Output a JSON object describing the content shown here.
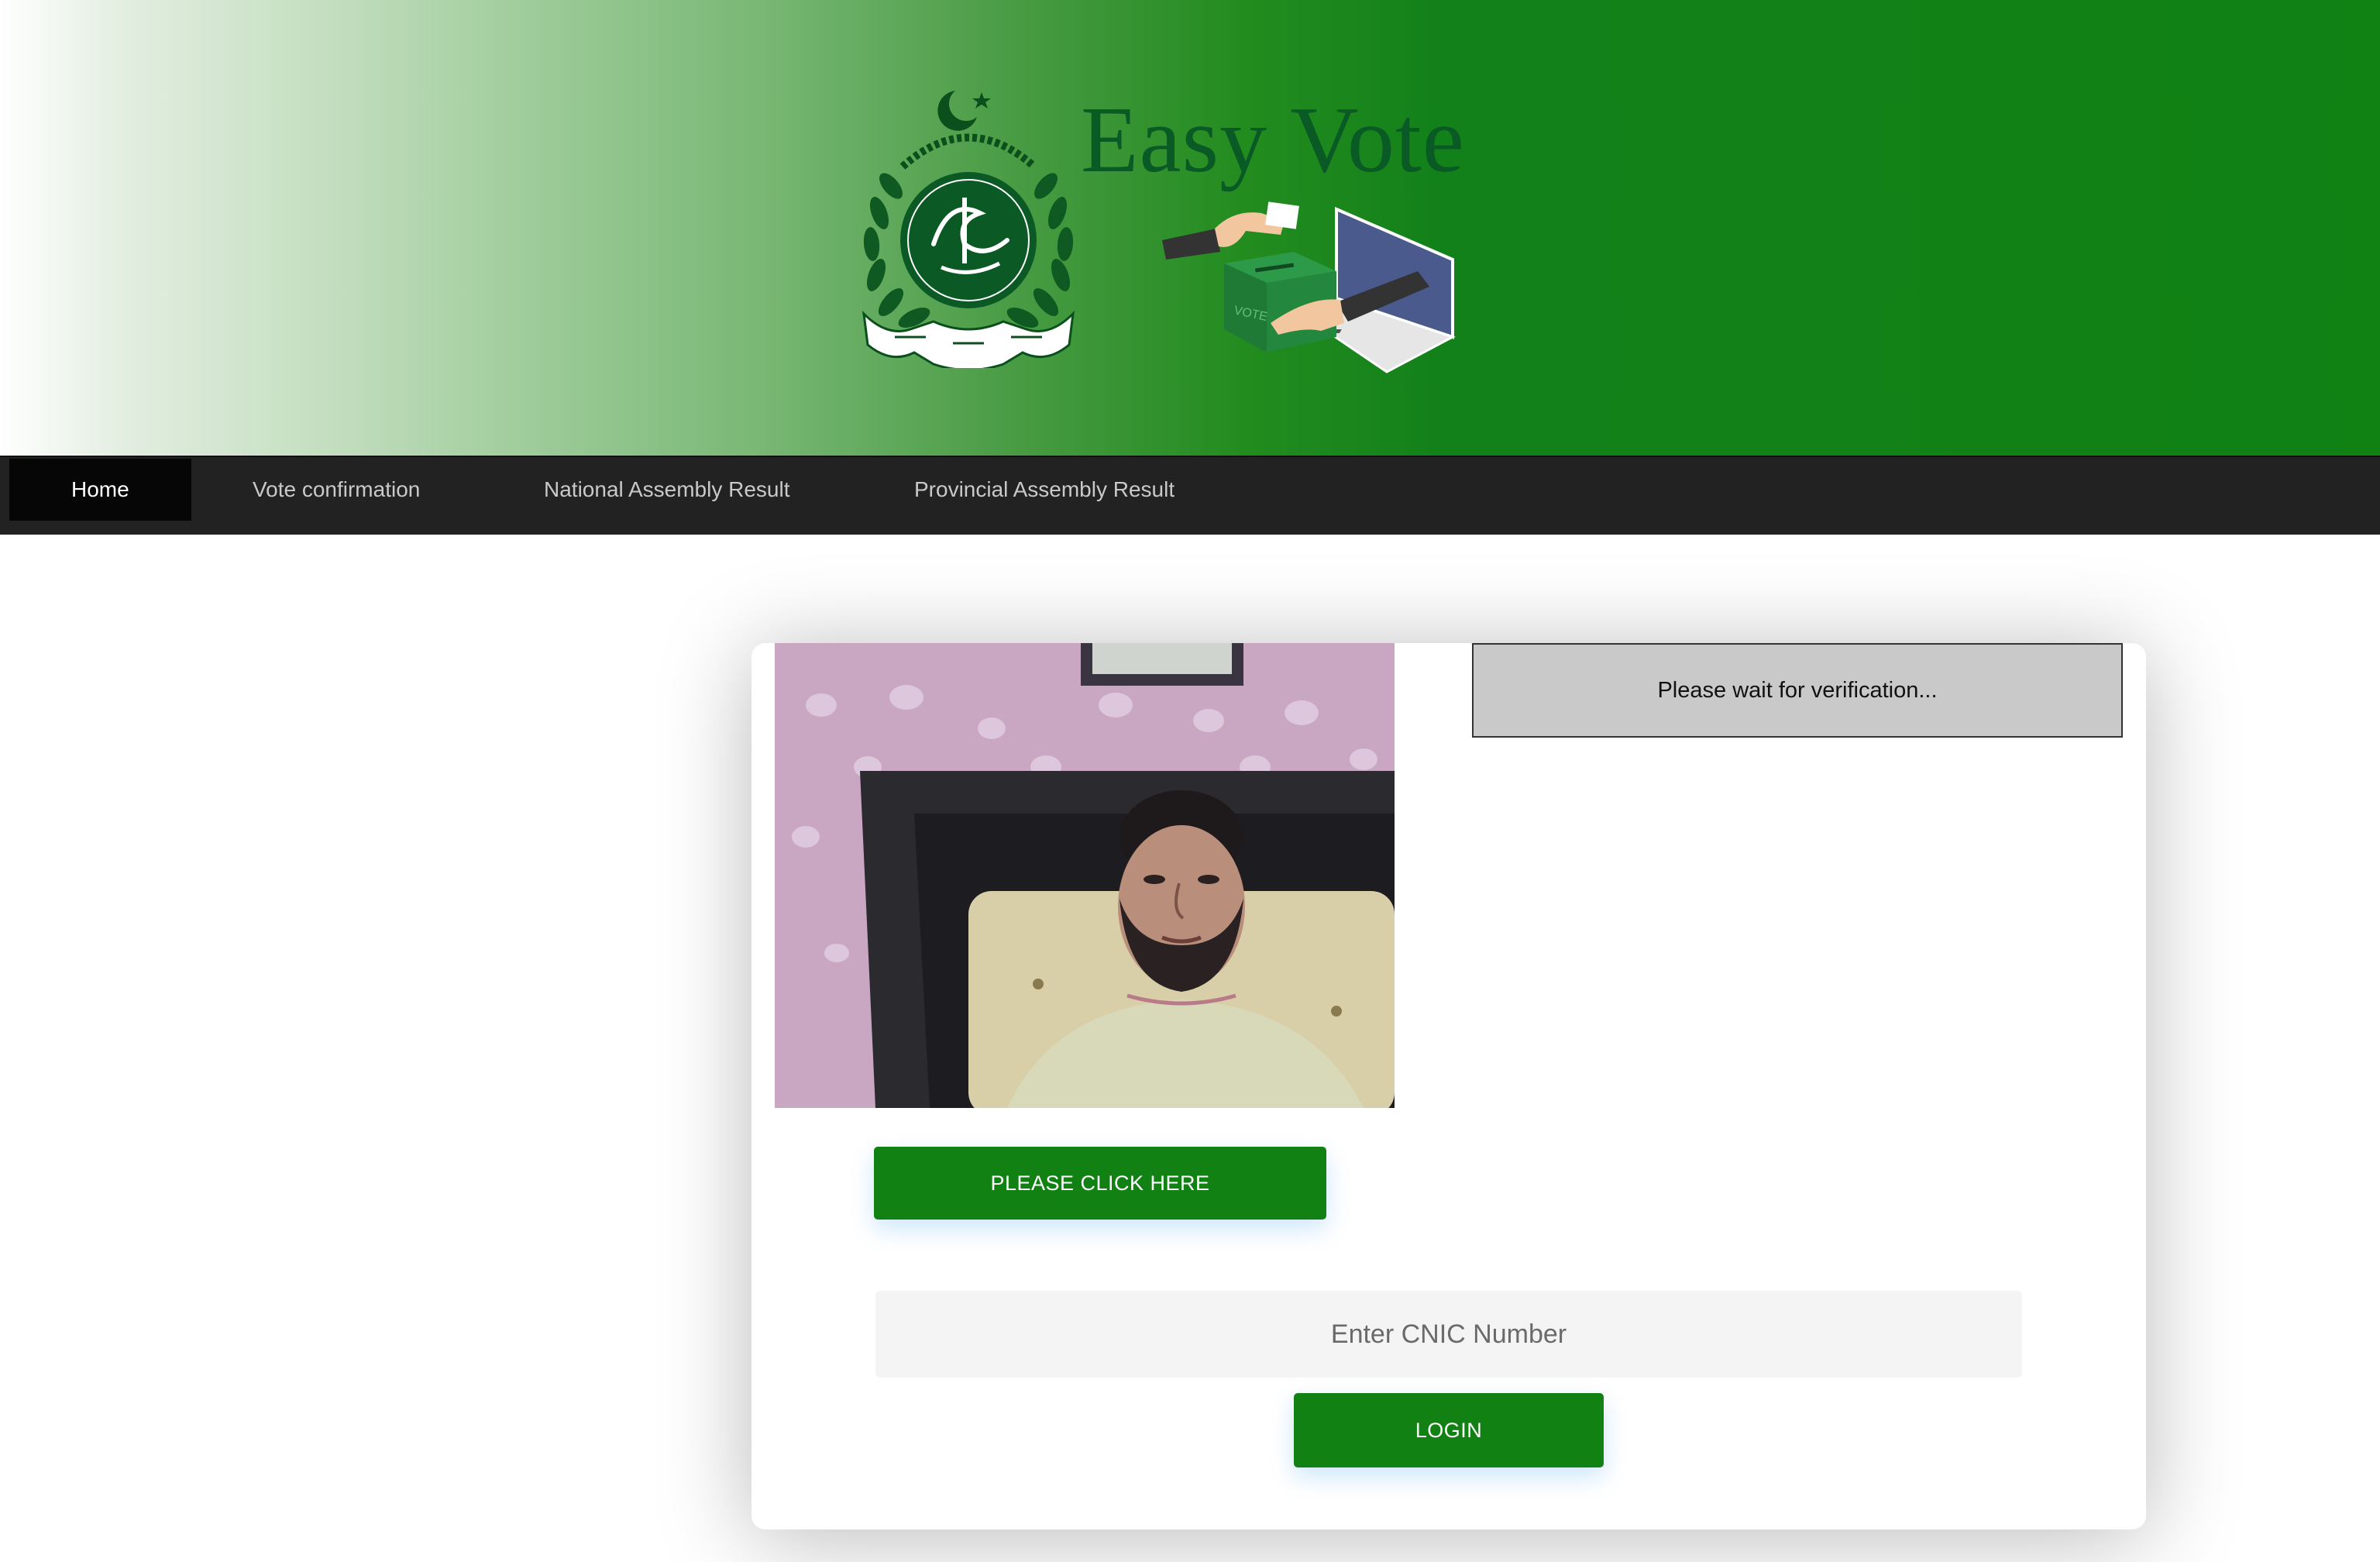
{
  "header": {
    "brand_title": "Easy Vote",
    "emblem_icon": "ecp-emblem-icon",
    "ballot_icon": "online-voting-illustration-icon",
    "colors": {
      "banner_green": "#108113",
      "title_green": "#0a5a25"
    }
  },
  "navbar": {
    "items": [
      {
        "label": "Home",
        "active": true
      },
      {
        "label": "Vote confirmation",
        "active": false
      },
      {
        "label": "National Assembly Result",
        "active": false
      },
      {
        "label": "Provincial Assembly Result",
        "active": false
      }
    ]
  },
  "verification": {
    "status_text": "Please wait for verification...",
    "capture_button_label": "PLEASE CLICK HERE",
    "webcam_icon": "webcam-feed"
  },
  "login": {
    "cnic_placeholder": "Enter CNIC Number",
    "cnic_value": "",
    "login_button_label": "LOGIN"
  },
  "colors": {
    "button_green": "#118114",
    "navbar_bg": "#222222",
    "nav_active_bg": "#060606",
    "status_bg": "#c9c9c9"
  }
}
